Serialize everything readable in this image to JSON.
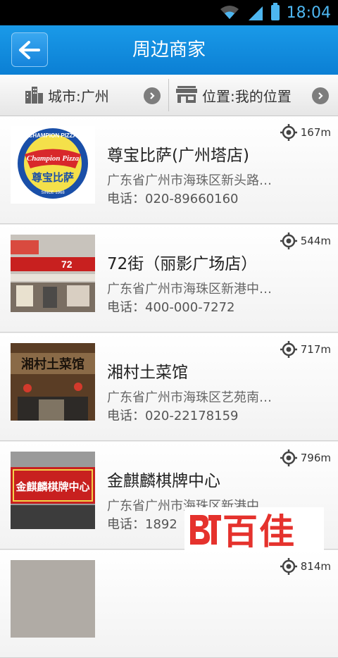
{
  "status_bar": {
    "time": "18:04"
  },
  "header": {
    "title": "周边商家",
    "back_icon": "back-arrow-icon"
  },
  "filters": {
    "city_label": "城市:广州",
    "location_label": "位置:我的位置"
  },
  "items": [
    {
      "name": "尊宝比萨(广州塔店)",
      "address": "广东省广州市海珠区新头路…",
      "phone": "电话：020-89660160",
      "distance": "167m"
    },
    {
      "name": "72街（丽影广场店）",
      "address": "广东省广州市海珠区新港中…",
      "phone": "电话：400-000-7272",
      "distance": "544m"
    },
    {
      "name": "湘村土菜馆",
      "address": "广东省广州市海珠区艺苑南…",
      "phone": "电话：020-22178159",
      "distance": "717m"
    },
    {
      "name": "金麒麟棋牌中心",
      "address": "广东省广州市海珠区新港中…",
      "phone": "电话：1892",
      "distance": "796m"
    },
    {
      "name": "",
      "address": "",
      "phone": "",
      "distance": "814m"
    }
  ],
  "thumb_texts": {
    "champion_top": "CHAMPION PIZZA",
    "champion_script": "Champion Pizza",
    "champion_cn": "尊宝比萨",
    "champion_since": "SINCE 1968",
    "shop72": "72",
    "xiangcun": "湘村土菜馆",
    "jinqilin": "金麒麟棋牌中心"
  },
  "watermark": {
    "text": "百佳"
  }
}
